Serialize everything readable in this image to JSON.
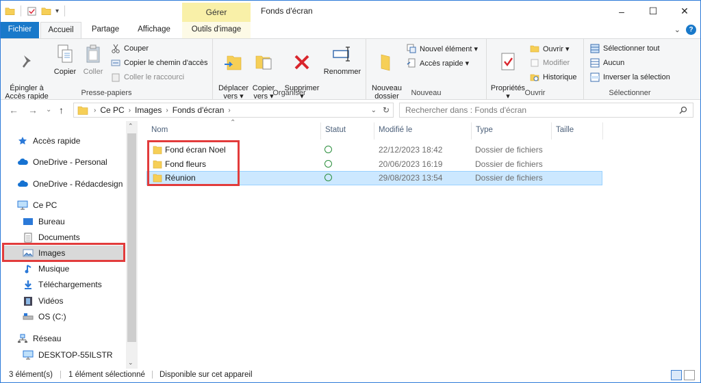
{
  "window": {
    "contextual_tab": "Gérer",
    "title": "Fonds d'écran",
    "controls": [
      "–",
      "☐",
      "✕"
    ]
  },
  "ribbon_tabs": [
    "Fichier",
    "Accueil",
    "Partage",
    "Affichage",
    "Outils d'image"
  ],
  "ribbon": {
    "presse_papiers": {
      "label": "Presse-papiers",
      "pin": "Épingler à\nAccès rapide",
      "copy": "Copier",
      "paste": "Coller",
      "cut": "Couper",
      "copy_path": "Copier le chemin d'accès",
      "paste_shortcut": "Coller le raccourci"
    },
    "organiser": {
      "label": "Organiser",
      "move": "Déplacer\nvers ▾",
      "copy_to": "Copier\nvers ▾",
      "delete": "Supprimer\n▾",
      "rename": "Renommer"
    },
    "nouveau": {
      "label": "Nouveau",
      "new_folder": "Nouveau\ndossier",
      "new_item": "Nouvel élément ▾",
      "easy_access": "Accès rapide ▾"
    },
    "ouvrir": {
      "label": "Ouvrir",
      "properties": "Propriétés\n▾",
      "open": "Ouvrir ▾",
      "edit": "Modifier",
      "history": "Historique"
    },
    "selectionner": {
      "label": "Sélectionner",
      "select_all": "Sélectionner tout",
      "select_none": "Aucun",
      "invert": "Inverser la sélection"
    }
  },
  "address": {
    "crumbs": [
      "Ce PC",
      "Images",
      "Fonds d'écran"
    ],
    "search_placeholder": "Rechercher dans : Fonds d'écran"
  },
  "nav": {
    "quick_access": "Accès rapide",
    "onedrive_personal": "OneDrive - Personal",
    "onedrive_work": "OneDrive - Rédacdesign",
    "this_pc": "Ce PC",
    "desktop": "Bureau",
    "documents": "Documents",
    "images": "Images",
    "music": "Musique",
    "downloads": "Téléchargements",
    "videos": "Vidéos",
    "os_drive": "OS (C:)",
    "network": "Réseau",
    "desktop_pc": "DESKTOP-55ILSTR"
  },
  "columns": [
    "Nom",
    "Statut",
    "Modifié le",
    "Type",
    "Taille"
  ],
  "files": [
    {
      "name": "Fond écran Noel",
      "modified": "22/12/2023 18:42",
      "type": "Dossier de fichiers"
    },
    {
      "name": "Fond fleurs",
      "modified": "20/06/2023 16:19",
      "type": "Dossier de fichiers"
    },
    {
      "name": "Réunion",
      "modified": "29/08/2023 13:54",
      "type": "Dossier de fichiers"
    }
  ],
  "statusbar": {
    "count": "3 élément(s)",
    "selected": "1 élément sélectionné",
    "availability": "Disponible sur cet appareil"
  },
  "colors": {
    "accent": "#1979ca",
    "highlight_box": "#e23b3b",
    "selection": "#cce8ff",
    "folder": "#f6cf57",
    "status_ok": "#2a8e3c"
  }
}
